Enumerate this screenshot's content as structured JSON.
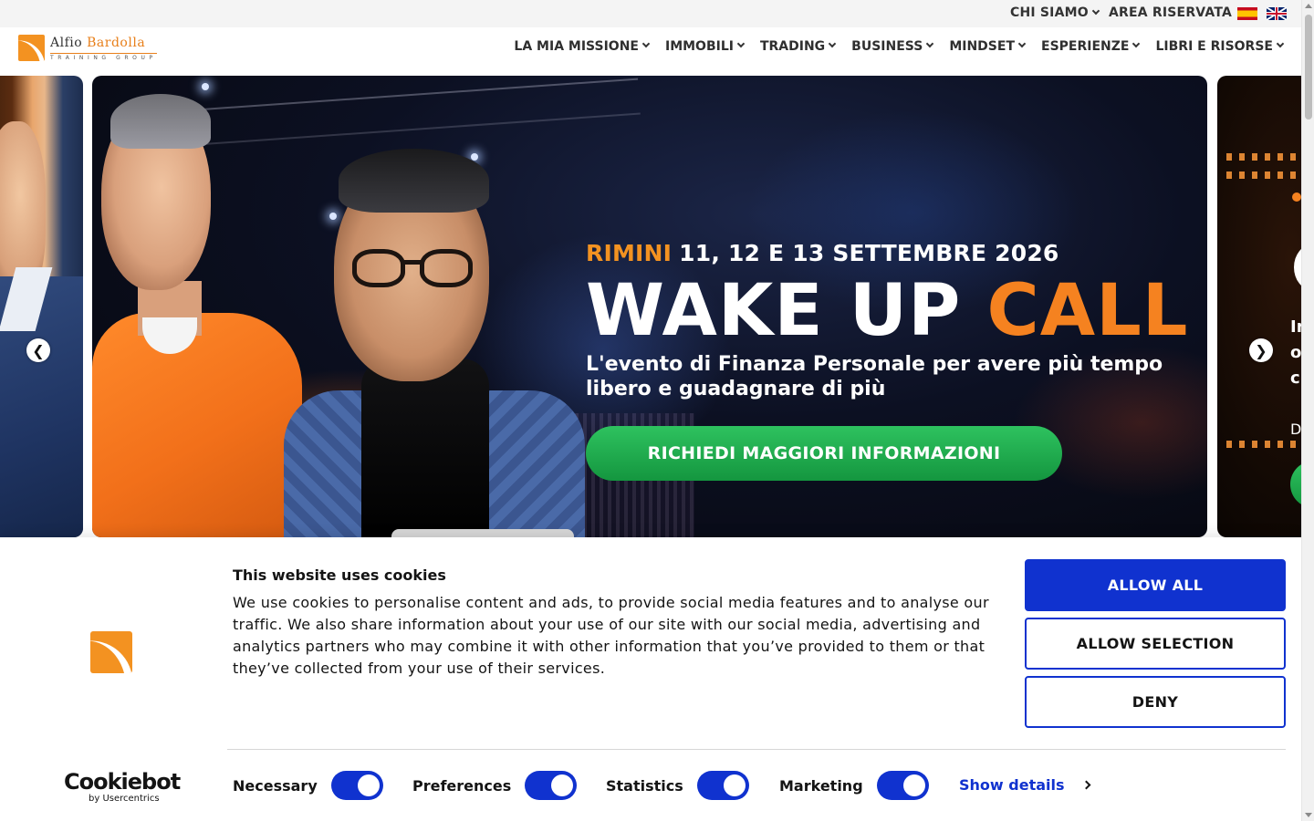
{
  "topbar": {
    "chi_siamo": "CHI SIAMO",
    "area_riservata": "AREA RISERVATA"
  },
  "logo": {
    "name_first": "Alfio",
    "name_second": "Bardolla",
    "subtitle": "TRAINING GROUP"
  },
  "nav": {
    "items": [
      {
        "label": "LA MIA MISSIONE"
      },
      {
        "label": "IMMOBILI"
      },
      {
        "label": "TRADING"
      },
      {
        "label": "BUSINESS"
      },
      {
        "label": "MINDSET"
      },
      {
        "label": "ESPERIENZE"
      },
      {
        "label": "LIBRI E RISORSE"
      }
    ]
  },
  "hero": {
    "city": "RIMINI",
    "dates": "11, 12 E 13 SETTEMBRE 2026",
    "title_white": "WAKE UP",
    "title_accent": "CALL",
    "subtitle": "L'evento di Finanza Personale per avere più tempo libero e guadagnare di più",
    "cta": "RICHIEDI MAGGIORI INFORMAZIONI"
  },
  "next_slide": {
    "line1": "In",
    "line2": "o",
    "line3": "c",
    "line4": "D"
  },
  "cookie": {
    "title": "This website uses cookies",
    "text": "We use cookies to personalise content and ads, to provide social media features and to analyse our traffic. We also share information about your use of our site with our social media, advertising and analytics partners who may combine it with other information that you’ve provided to them or that they’ve collected from your use of their services.",
    "allow_all": "ALLOW ALL",
    "allow_selection": "ALLOW SELECTION",
    "deny": "DENY",
    "brand_word": "Cookiebot",
    "brand_by": "by Usercentrics",
    "toggles": [
      {
        "label": "Necessary",
        "on": true
      },
      {
        "label": "Preferences",
        "on": true
      },
      {
        "label": "Statistics",
        "on": true
      },
      {
        "label": "Marketing",
        "on": true
      }
    ],
    "show_details": "Show details"
  },
  "colors": {
    "brand_orange": "#f39221",
    "cookie_blue": "#1032cf",
    "cta_green": "#1fa84c"
  }
}
